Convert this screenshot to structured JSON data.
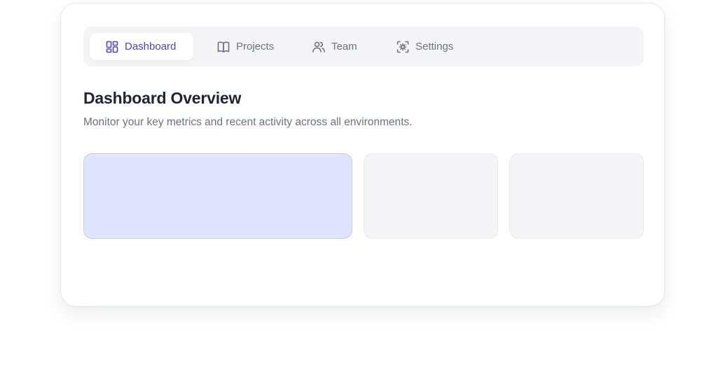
{
  "tabs": [
    {
      "label": "Dashboard",
      "icon": "layout-grid-icon",
      "active": true
    },
    {
      "label": "Projects",
      "icon": "book-open-icon",
      "active": false
    },
    {
      "label": "Team",
      "icon": "users-icon",
      "active": false
    },
    {
      "label": "Settings",
      "icon": "settings-scan-icon",
      "active": false
    }
  ],
  "header": {
    "title": "Dashboard Overview",
    "subtitle": "Monitor your key metrics and recent activity across all environments."
  },
  "colors": {
    "accent": "#4f46b8",
    "primary_panel": "#e0e4fc",
    "muted_panel": "#f5f5f7",
    "tabbar_bg": "#f4f4f6"
  }
}
